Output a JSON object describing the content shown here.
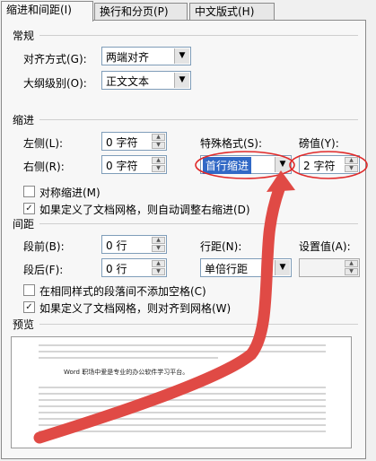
{
  "tabs": [
    "缩进和间距(I)",
    "换行和分页(P)",
    "中文版式(H)"
  ],
  "sections": {
    "general": "常规",
    "indent": "缩进",
    "spacing": "间距",
    "preview": "预览"
  },
  "general": {
    "alignment_label": "对齐方式(G):",
    "alignment_value": "两端对齐",
    "outline_label": "大纲级别(O):",
    "outline_value": "正文文本"
  },
  "indent": {
    "left_label": "左侧(L):",
    "left_value": "0 字符",
    "right_label": "右侧(R):",
    "right_value": "0 字符",
    "special_label": "特殊格式(S):",
    "special_value": "首行缩进",
    "by_label": "磅值(Y):",
    "by_value": "2 字符",
    "mirror_label": "对称缩进(M)",
    "mirror_checked": false,
    "auto_right_label": "如果定义了文档网格，则自动调整右缩进(D)",
    "auto_right_checked": true
  },
  "spacing": {
    "before_label": "段前(B):",
    "before_value": "0 行",
    "after_label": "段后(F):",
    "after_value": "0 行",
    "line_label": "行距(N):",
    "line_value": "单倍行距",
    "at_label": "设置值(A):",
    "at_value": "",
    "no_space_label": "在相同样式的段落间不添加空格(C)",
    "no_space_checked": false,
    "snap_grid_label": "如果定义了文档网格，则对齐到网格(W)",
    "snap_grid_checked": true
  },
  "preview_text": "Word 职场中爱是专业的办公软件学习平台。",
  "colors": {
    "annotation": "#e02a2a",
    "arrow": "#e04a45"
  }
}
